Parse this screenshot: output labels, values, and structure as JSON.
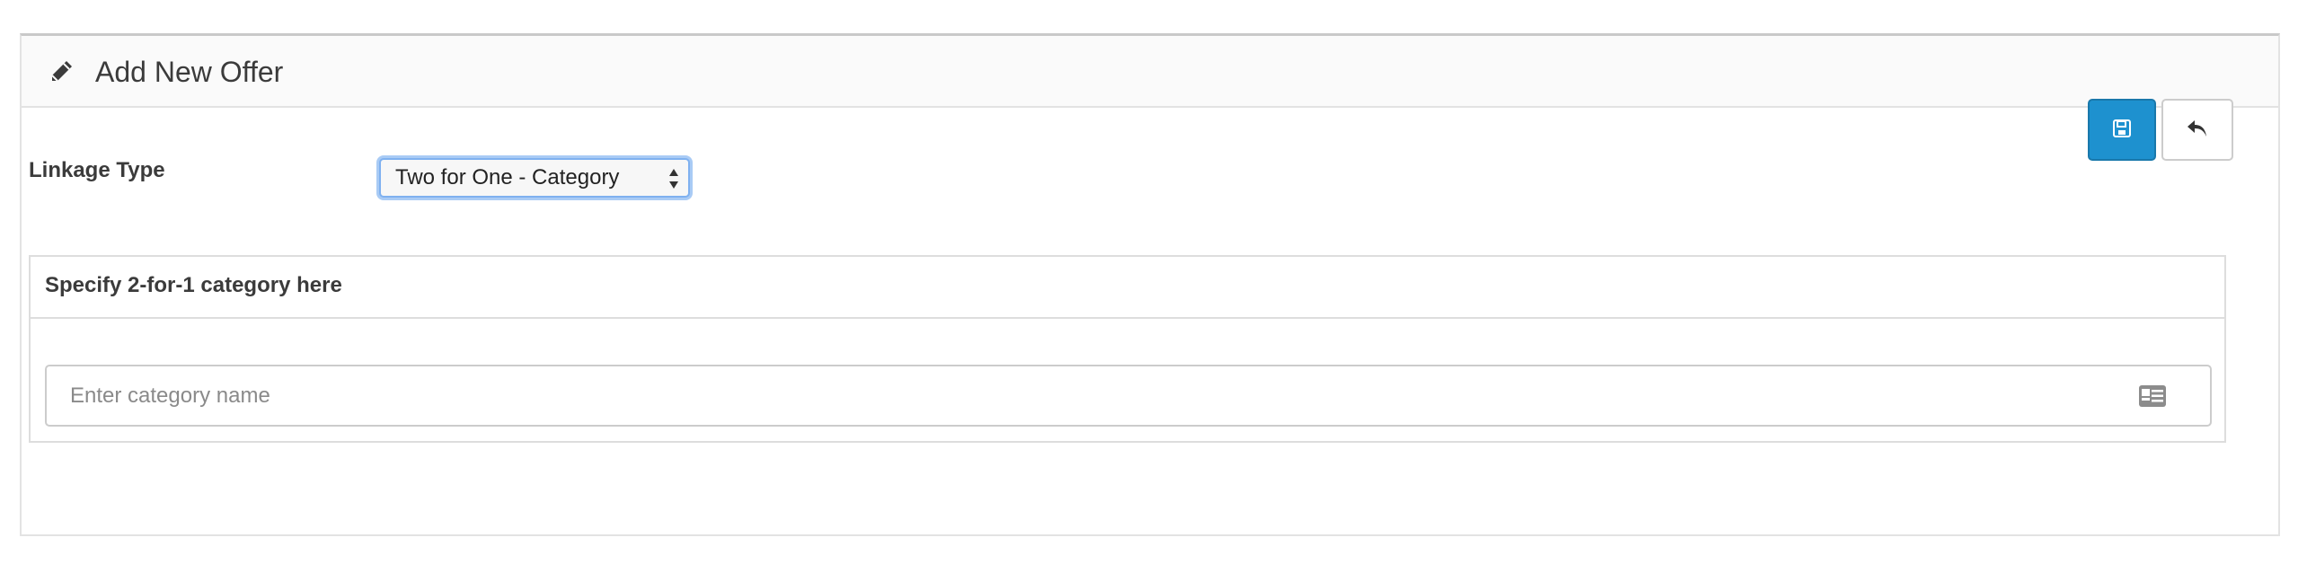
{
  "panel": {
    "title": "Add New Offer",
    "title_icon": "pencil-icon"
  },
  "toolbar": {
    "save_icon": "save-icon",
    "save_color": "#1e91cf",
    "back_icon": "reply-icon"
  },
  "form": {
    "linkage_type_label": "Linkage Type",
    "linkage_type_value": "Two for One - Category",
    "category_section_title": "Specify 2-for-1 category here",
    "category_input_placeholder": "Enter category name",
    "category_input_value": "",
    "category_input_icon": "id-card-icon"
  }
}
